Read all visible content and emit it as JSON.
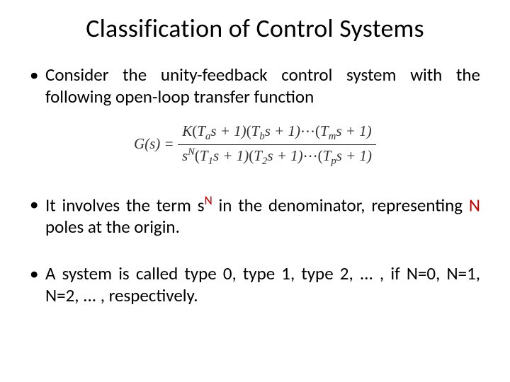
{
  "title": "Classification of Control Systems",
  "bullets": {
    "b1": "Consider the unity-feedback control system with the following open-loop transfer function",
    "b2_pre": "It involves the term s",
    "b2_sup": "N",
    "b2_mid": " in the denominator, representing ",
    "b2_red": "N",
    "b2_post": " poles at the origin.",
    "b3": "A system is called type 0, type 1, type 2, ... , if N=0, N=1, N=2, ... , respectively."
  },
  "formula": {
    "lhs": "G(s) = ",
    "num_parts": {
      "K": "K",
      "open": "(",
      "T": "T",
      "a": "a",
      "b": "b",
      "m": "m",
      "s1": "s + 1)",
      "dots": "⋯"
    },
    "den_parts": {
      "s": "s",
      "N": "N",
      "open": "(",
      "T": "T",
      "one": "1",
      "two": "2",
      "p": "p",
      "s1": "s + 1)",
      "dots": "⋯"
    }
  }
}
